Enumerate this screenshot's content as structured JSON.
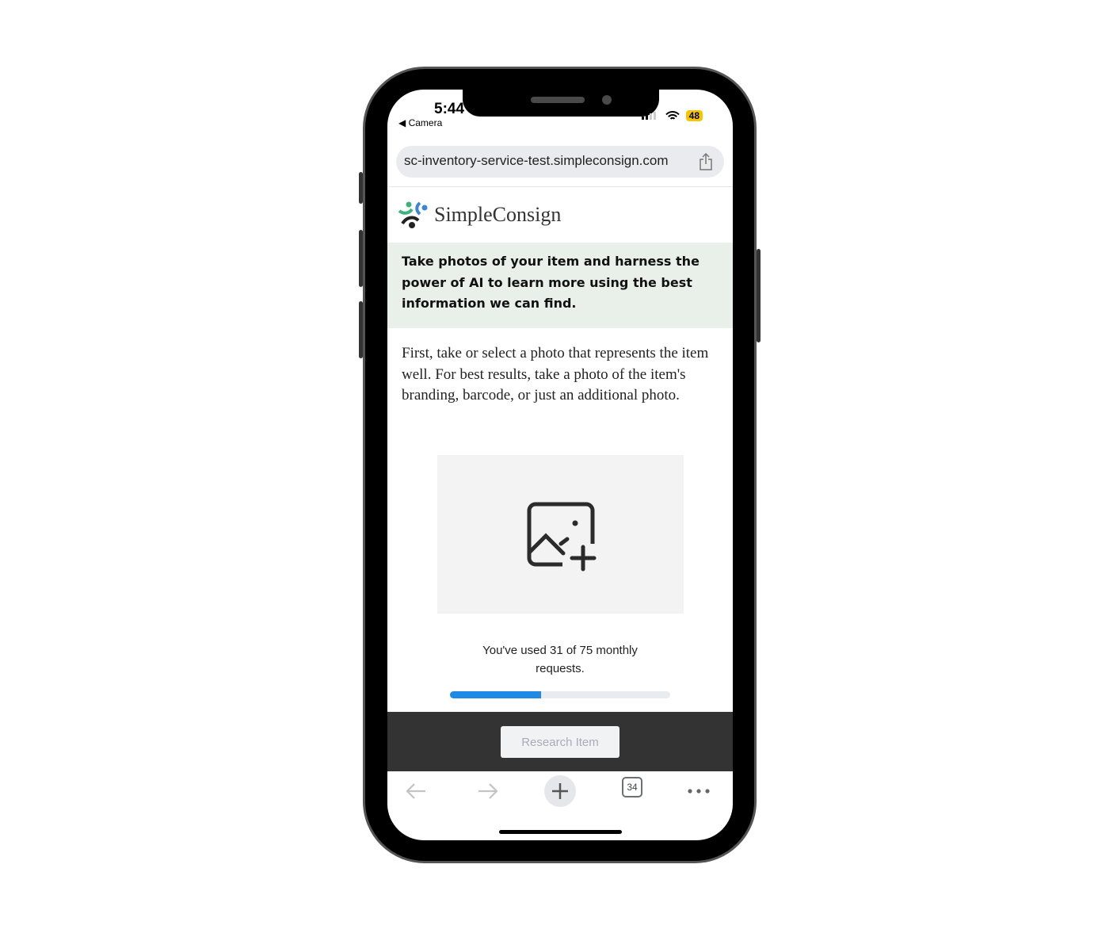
{
  "status_bar": {
    "time": "5:44",
    "back_app": "◀ Camera",
    "battery": "48"
  },
  "browser": {
    "url": "sc-inventory-service-test.simpleconsign.com",
    "tab_count": "34"
  },
  "logo": {
    "text": "SimpleConsign"
  },
  "banner": {
    "text": "Take photos of your item and harness the power of AI to learn more using the best information we can find."
  },
  "intro": {
    "text": "First, take or select a photo that represents the item well. For best results, take a photo of the item's branding, barcode, or just an additional photo."
  },
  "photo_picker": {
    "icon": "image-plus-icon"
  },
  "usage": {
    "text": "You've used 31 of 75 monthly requests.",
    "used": 31,
    "limit": 75,
    "progress_color": "#1f8ae6"
  },
  "actions": {
    "research_label": "Research Item"
  }
}
